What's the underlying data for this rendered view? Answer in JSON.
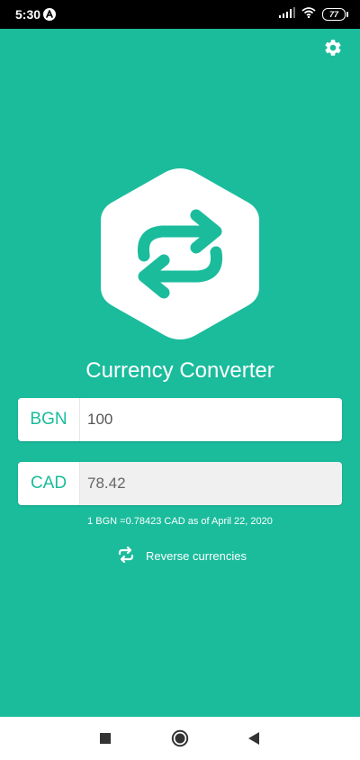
{
  "status_bar": {
    "time": "5:30",
    "battery": "77"
  },
  "icons": {
    "settings": "gear-icon",
    "logo": "swap-arrows-icon",
    "reverse": "swap-arrows-icon"
  },
  "app_title": "Currency Converter",
  "from": {
    "code": "BGN",
    "value": "100"
  },
  "to": {
    "code": "CAD",
    "value": "78.42"
  },
  "rate_text": "1 BGN =0.78423 CAD as of April 22, 2020",
  "reverse_label": "Reverse currencies",
  "colors": {
    "accent": "#1abc9c",
    "white": "#ffffff",
    "output_bg": "#f0f0f0"
  }
}
